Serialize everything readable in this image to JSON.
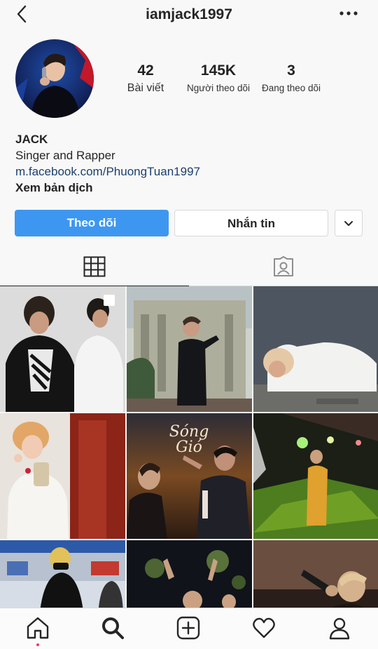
{
  "header": {
    "username": "iamjack1997",
    "back_icon": "chevron-left-icon",
    "more_icon": "more-horizontal-icon"
  },
  "profile": {
    "stats": [
      {
        "value": "42",
        "label": "Bài viết"
      },
      {
        "value": "145K",
        "label": "Người theo dõi"
      },
      {
        "value": "3",
        "label": "Đang theo dõi"
      }
    ],
    "name": "JACK",
    "bio": "Singer and Rapper",
    "link": "m.facebook.com/PhuongTuan1997",
    "translate": "Xem bản dịch"
  },
  "actions": {
    "follow_label": "Theo dõi",
    "message_label": "Nhắn tin",
    "more_icon": "chevron-down-icon"
  },
  "tabs": [
    {
      "name": "grid",
      "icon": "grid-icon",
      "active": true
    },
    {
      "name": "tagged",
      "icon": "tagged-icon",
      "active": false
    }
  ],
  "poster_text": "Sóng Gió",
  "bottom_nav": [
    {
      "icon": "home-icon"
    },
    {
      "icon": "search-icon"
    },
    {
      "icon": "add-post-icon"
    },
    {
      "icon": "heart-icon"
    },
    {
      "icon": "profile-icon"
    }
  ],
  "colors": {
    "accent": "#3d97f0",
    "link": "#1b3f6e",
    "notification": "#e4405f"
  }
}
